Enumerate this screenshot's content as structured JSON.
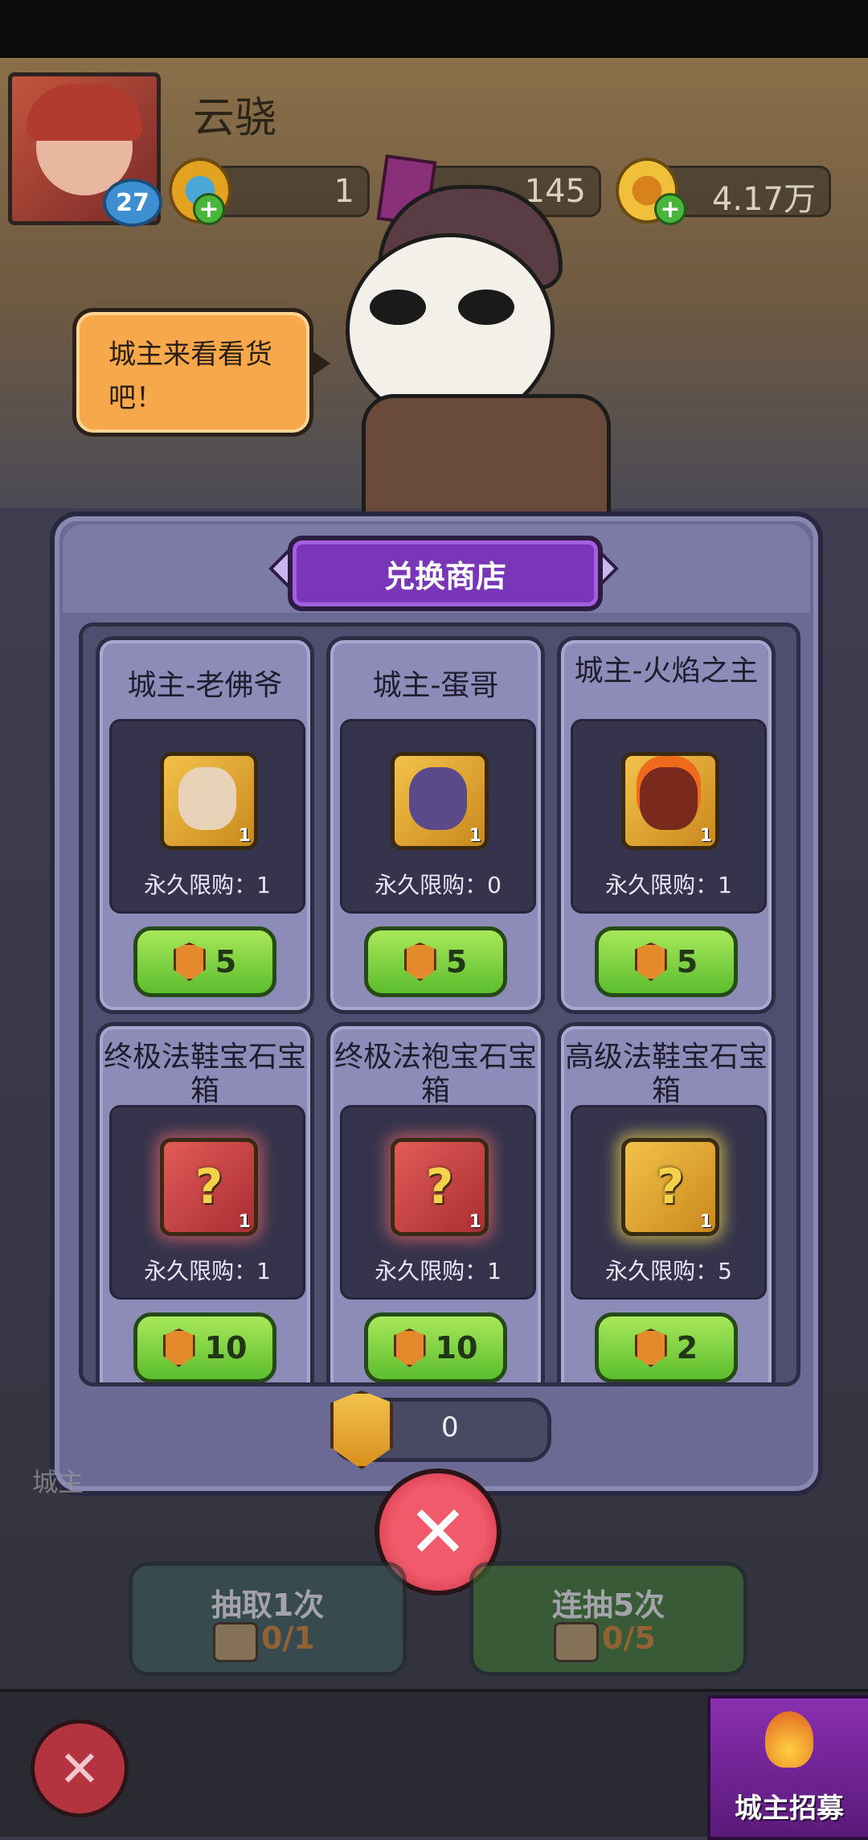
{
  "player": {
    "name": "云骁",
    "level": "27"
  },
  "resources": [
    {
      "name": "blue-coin",
      "value": "1"
    },
    {
      "name": "purple-gem",
      "value": "145"
    },
    {
      "name": "gold-coin",
      "value": "4.17万"
    }
  ],
  "npc": {
    "speech": "城主来看看货吧！"
  },
  "shop": {
    "title": "兑换商店",
    "items": [
      {
        "name": "城主-老佛爷",
        "count": "1",
        "limit": "永久限购：1",
        "price": "5",
        "icon": "hero-old-man-portrait"
      },
      {
        "name": "城主-蛋哥",
        "count": "1",
        "limit": "永久限购：0",
        "price": "5",
        "icon": "hero-demon-portrait"
      },
      {
        "name": "城主-火焰之主",
        "count": "1",
        "limit": "永久限购：1",
        "price": "5",
        "icon": "hero-flame-lord-portrait"
      },
      {
        "name": "终极法鞋宝石宝箱",
        "count": "1",
        "limit": "永久限购：1",
        "price": "10",
        "icon": "gem-chest-red"
      },
      {
        "name": "终极法袍宝石宝箱",
        "count": "1",
        "limit": "永久限购：1",
        "price": "10",
        "icon": "gem-chest-red"
      },
      {
        "name": "高级法鞋宝石宝箱",
        "count": "1",
        "limit": "永久限购：5",
        "price": "2",
        "icon": "gem-chest-gold"
      }
    ],
    "balance": "0"
  },
  "draw": {
    "single_label": "抽取1次",
    "single_count": "0/1",
    "multi_label": "连抽5次",
    "multi_count": "0/5"
  },
  "bottom": {
    "recruit_label": "城主招募",
    "side_label": "城主"
  },
  "colors": {
    "dialog": "#6b6a94",
    "title_plate": "#7a36b8",
    "buy_button": "#5cbd2e",
    "close": "#e0404e"
  }
}
